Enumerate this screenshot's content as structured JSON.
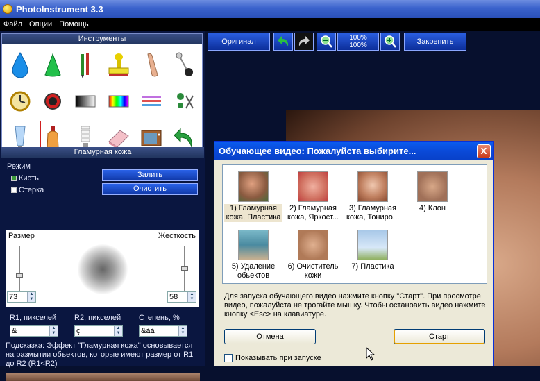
{
  "window": {
    "title": "PhotoInstrument 3.3"
  },
  "menu": [
    "Файл",
    "Опции",
    "Помощь"
  ],
  "tools_panel": {
    "title": "Инструменты"
  },
  "glamor_panel": {
    "title": "Гламурная кожа",
    "mode_label": "Режим",
    "brush_label": "Кисть",
    "brush_checked": true,
    "eraser_label": "Стерка",
    "eraser_checked": false,
    "fill_button": "Залить",
    "clear_button": "Очистить",
    "size_label": "Размер",
    "hardness_label": "Жесткость",
    "size_value": "73",
    "hardness_value": "58",
    "r1_label": "R1, пикселей",
    "r2_label": "R2, пикселей",
    "degree_label": "Степень, %",
    "r1_value": "&",
    "r2_value": "ç",
    "degree_value": "&àà",
    "hint": "Подсказка: Эффект \"Гламурная кожа\" основывается на размытии объектов, которые имеют размер от R1 до R2 (R1<R2)"
  },
  "toolbar": {
    "original_button": "Оригинал",
    "zoom_line1": "100%",
    "zoom_line2": "100%",
    "pin_button": "Закрепить"
  },
  "dialog": {
    "title": "Обучающее видео: Пожалуйста выбирите...",
    "close": "X",
    "videos": [
      {
        "label_line1": "1) Гламурная",
        "label_line2": "кожа, Пластика",
        "selected": true
      },
      {
        "label_line1": "2) Гламурная",
        "label_line2": "кожа, Яркост...",
        "selected": false
      },
      {
        "label_line1": "3) Гламурная",
        "label_line2": "кожа, Тониро...",
        "selected": false
      },
      {
        "label_line1": "4) Клон",
        "label_line2": "",
        "selected": false
      },
      {
        "label_line1": "5) Удаление",
        "label_line2": "обьектов",
        "selected": false
      },
      {
        "label_line1": "6) Очиститель",
        "label_line2": "кожи",
        "selected": false
      },
      {
        "label_line1": "7) Пластика",
        "label_line2": "",
        "selected": false
      }
    ],
    "instructions": "Для запуска обучающего видео нажмите кнопку \"Старт\". При просмотре видео, пожалуйста не трогайте мышку. Чтобы остановить видео нажмите кнопку <Esc> на клавиатуре.",
    "cancel_button": "Отмена",
    "start_button": "Старт",
    "show_on_start_label": "Показывать при запуске",
    "show_on_start_checked": false
  }
}
